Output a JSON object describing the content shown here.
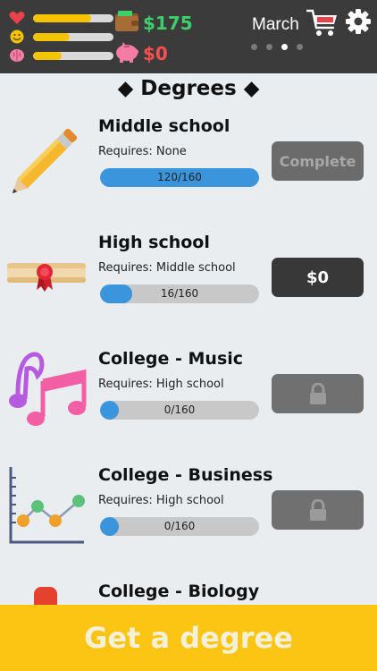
{
  "status": {
    "month": "March",
    "money": "$175",
    "savings": "$0",
    "health_level": 0.72,
    "happiness_level": 0.45,
    "smarts_level": 0.35,
    "page_dots": 4,
    "active_page": 2,
    "colors": {
      "money": "#3ecf6a",
      "savings": "#ff4f4f",
      "bar_fill": "#f5c400"
    }
  },
  "title": "◆ Degrees ◆",
  "degrees": [
    {
      "name": "Middle school",
      "requires": "Requires: None",
      "progress_text": "120/160",
      "progress": 1.0,
      "action": "Complete",
      "action_state": "complete"
    },
    {
      "name": "High school",
      "requires": "Requires: Middle school",
      "progress_text": "16/160",
      "progress": 0.1,
      "action": "$0",
      "action_state": "buy"
    },
    {
      "name": "College - Music",
      "requires": "Requires: High school",
      "progress_text": "0/160",
      "progress": 0.0,
      "action": "",
      "action_state": "locked"
    },
    {
      "name": "College - Business",
      "requires": "Requires: High school",
      "progress_text": "0/160",
      "progress": 0.0,
      "action": "",
      "action_state": "locked"
    },
    {
      "name": "College - Biology"
    }
  ],
  "cta_label": "Get a degree"
}
